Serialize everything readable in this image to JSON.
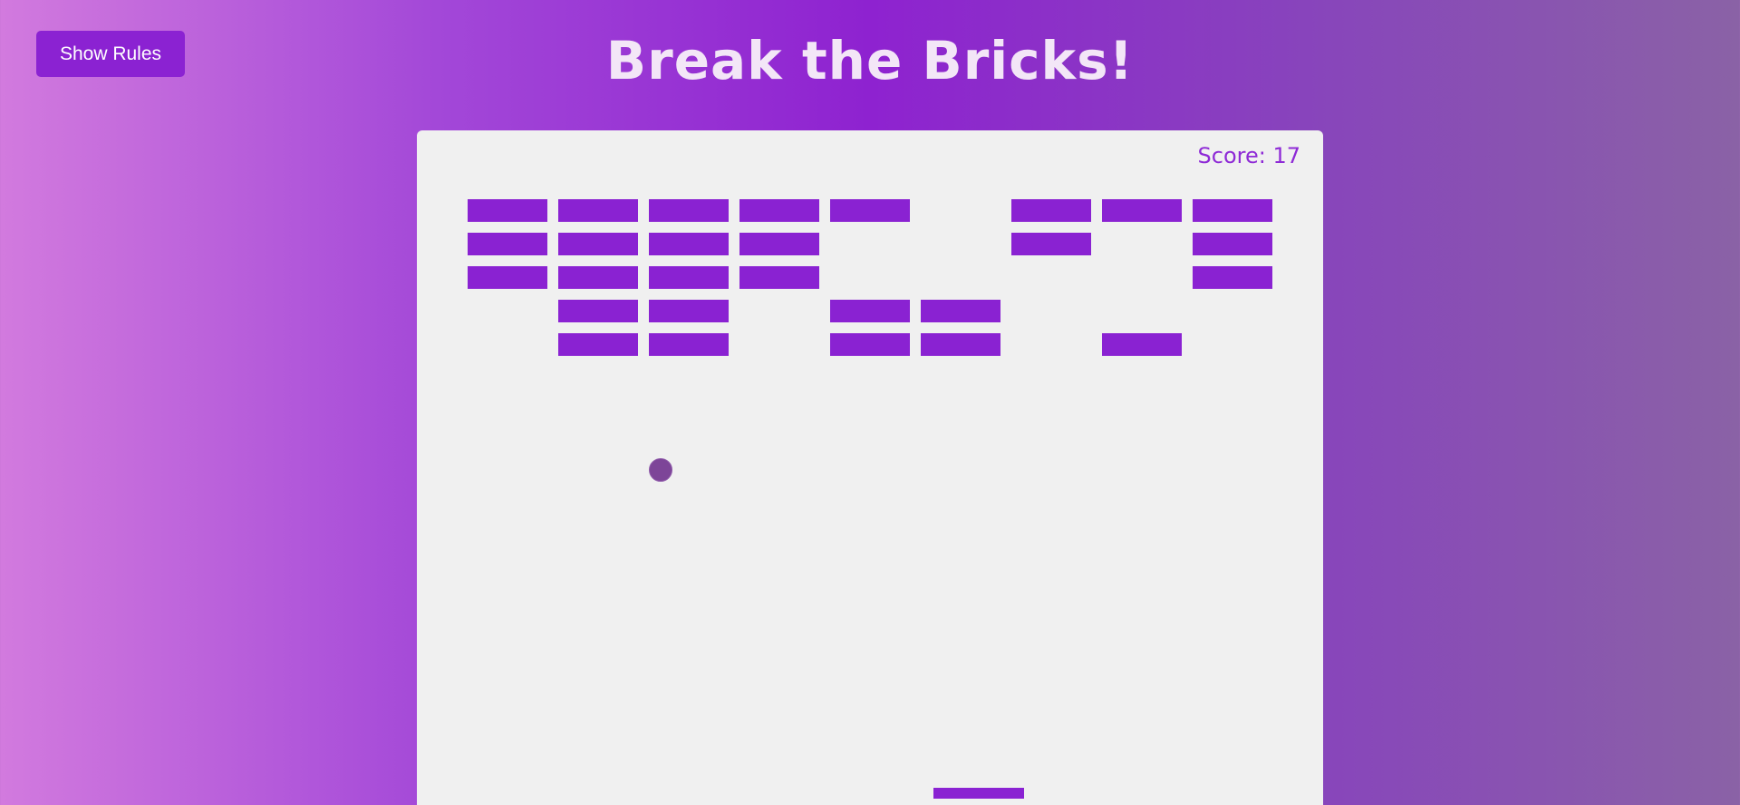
{
  "header": {
    "rules_button_label": "Show Rules",
    "title": "Break the Bricks!"
  },
  "game": {
    "score_text": "Score: 17",
    "score": 17,
    "brick_color": "#8a22d2",
    "ball_color": "#7d4598",
    "canvas_background": "#f0f0f0",
    "bricks": [
      {
        "row": 0,
        "col": 0
      },
      {
        "row": 0,
        "col": 1
      },
      {
        "row": 0,
        "col": 2
      },
      {
        "row": 0,
        "col": 3
      },
      {
        "row": 0,
        "col": 4
      },
      {
        "row": 0,
        "col": 6
      },
      {
        "row": 0,
        "col": 7
      },
      {
        "row": 0,
        "col": 8
      },
      {
        "row": 1,
        "col": 0
      },
      {
        "row": 1,
        "col": 1
      },
      {
        "row": 1,
        "col": 2
      },
      {
        "row": 1,
        "col": 3
      },
      {
        "row": 1,
        "col": 6
      },
      {
        "row": 1,
        "col": 8
      },
      {
        "row": 2,
        "col": 0
      },
      {
        "row": 2,
        "col": 1
      },
      {
        "row": 2,
        "col": 2
      },
      {
        "row": 2,
        "col": 3
      },
      {
        "row": 2,
        "col": 8
      },
      {
        "row": 3,
        "col": 1
      },
      {
        "row": 3,
        "col": 2
      },
      {
        "row": 3,
        "col": 4
      },
      {
        "row": 3,
        "col": 5
      },
      {
        "row": 4,
        "col": 1
      },
      {
        "row": 4,
        "col": 2
      },
      {
        "row": 4,
        "col": 4
      },
      {
        "row": 4,
        "col": 5
      },
      {
        "row": 4,
        "col": 7
      }
    ]
  }
}
